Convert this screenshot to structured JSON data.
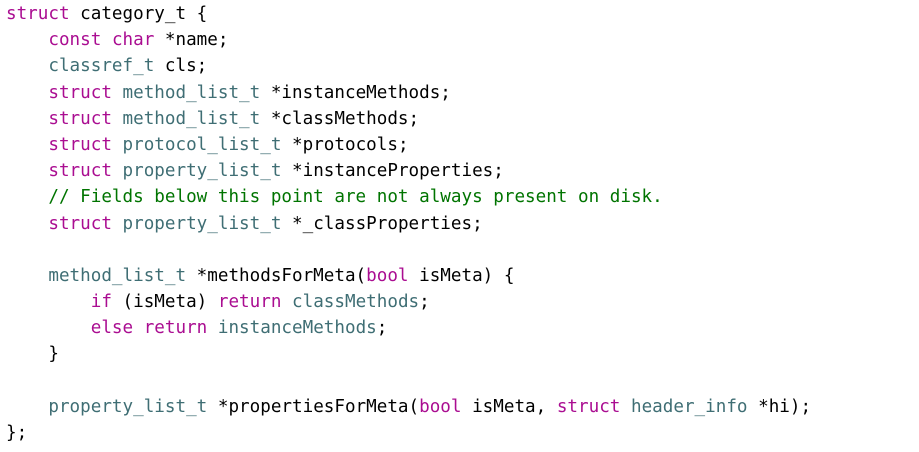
{
  "colors": {
    "background": "#ffffff",
    "keyword": "#aa0d91",
    "type": "#3f6e74",
    "plain": "#000000",
    "comment": "#007400"
  },
  "code": {
    "language": "c++",
    "lines": [
      [
        [
          "keyword",
          "struct"
        ],
        [
          "plain",
          " category_t {"
        ]
      ],
      [
        [
          "plain",
          "    "
        ],
        [
          "keyword",
          "const"
        ],
        [
          "plain",
          " "
        ],
        [
          "keyword",
          "char"
        ],
        [
          "plain",
          " *name;"
        ]
      ],
      [
        [
          "plain",
          "    "
        ],
        [
          "type",
          "classref_t"
        ],
        [
          "plain",
          " cls;"
        ]
      ],
      [
        [
          "plain",
          "    "
        ],
        [
          "keyword",
          "struct"
        ],
        [
          "plain",
          " "
        ],
        [
          "type",
          "method_list_t"
        ],
        [
          "plain",
          " *instanceMethods;"
        ]
      ],
      [
        [
          "plain",
          "    "
        ],
        [
          "keyword",
          "struct"
        ],
        [
          "plain",
          " "
        ],
        [
          "type",
          "method_list_t"
        ],
        [
          "plain",
          " *classMethods;"
        ]
      ],
      [
        [
          "plain",
          "    "
        ],
        [
          "keyword",
          "struct"
        ],
        [
          "plain",
          " "
        ],
        [
          "type",
          "protocol_list_t"
        ],
        [
          "plain",
          " *protocols;"
        ]
      ],
      [
        [
          "plain",
          "    "
        ],
        [
          "keyword",
          "struct"
        ],
        [
          "plain",
          " "
        ],
        [
          "type",
          "property_list_t"
        ],
        [
          "plain",
          " *instanceProperties;"
        ]
      ],
      [
        [
          "plain",
          "    "
        ],
        [
          "comment",
          "// Fields below this point are not always present on disk."
        ]
      ],
      [
        [
          "plain",
          "    "
        ],
        [
          "keyword",
          "struct"
        ],
        [
          "plain",
          " "
        ],
        [
          "type",
          "property_list_t"
        ],
        [
          "plain",
          " *_classProperties;"
        ]
      ],
      [],
      [
        [
          "plain",
          "    "
        ],
        [
          "type",
          "method_list_t"
        ],
        [
          "plain",
          " *methodsForMeta("
        ],
        [
          "keyword",
          "bool"
        ],
        [
          "plain",
          " isMeta) {"
        ]
      ],
      [
        [
          "plain",
          "        "
        ],
        [
          "keyword",
          "if"
        ],
        [
          "plain",
          " (isMeta) "
        ],
        [
          "keyword",
          "return"
        ],
        [
          "plain",
          " "
        ],
        [
          "type",
          "classMethods"
        ],
        [
          "plain",
          ";"
        ]
      ],
      [
        [
          "plain",
          "        "
        ],
        [
          "keyword",
          "else"
        ],
        [
          "plain",
          " "
        ],
        [
          "keyword",
          "return"
        ],
        [
          "plain",
          " "
        ],
        [
          "type",
          "instanceMethods"
        ],
        [
          "plain",
          ";"
        ]
      ],
      [
        [
          "plain",
          "    }"
        ]
      ],
      [],
      [
        [
          "plain",
          "    "
        ],
        [
          "type",
          "property_list_t"
        ],
        [
          "plain",
          " *propertiesForMeta("
        ],
        [
          "keyword",
          "bool"
        ],
        [
          "plain",
          " isMeta, "
        ],
        [
          "keyword",
          "struct"
        ],
        [
          "plain",
          " "
        ],
        [
          "type",
          "header_info"
        ],
        [
          "plain",
          " *hi);"
        ]
      ],
      [
        [
          "plain",
          "};"
        ]
      ]
    ]
  }
}
